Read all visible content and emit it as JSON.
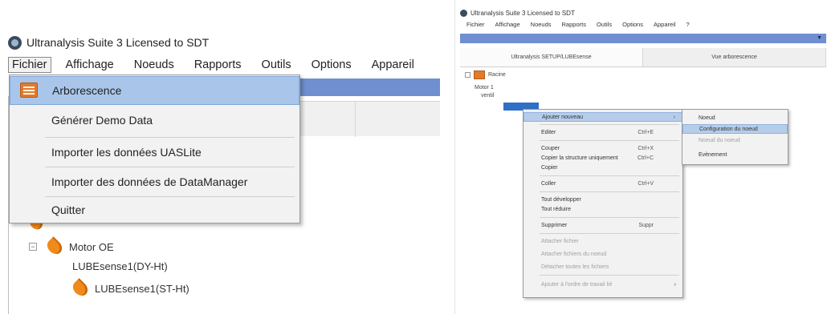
{
  "left": {
    "title": "Ultranalysis Suite 3 Licensed to SDT",
    "menubar": [
      "Fichier",
      "Affichage",
      "Noeuds",
      "Rapports",
      "Outils",
      "Options",
      "Appareil"
    ],
    "fichier_menu": [
      {
        "label": "Arborescence",
        "active": true
      },
      {
        "label": "Générer Demo Data"
      },
      {
        "label": "Importer les données UASLite"
      },
      {
        "label": "Importer des données de DataManager"
      },
      {
        "label": "Quitter"
      }
    ],
    "tree": {
      "motor": "Motor OE",
      "lube1": "LUBEsense1(DY-Ht)",
      "lube2": "LUBEsense1(ST-Ht)"
    }
  },
  "right": {
    "title": "Ultranalysis Suite 3 Licensed to SDT",
    "menubar": [
      "Fichier",
      "Affichage",
      "Noeuds",
      "Rapports",
      "Outils",
      "Options",
      "Appareil",
      "?"
    ],
    "tabs": [
      "Ultranalysis SETUP/LUBEsense",
      "Vue arborescence"
    ],
    "tree": [
      "Racine",
      "Motor 1",
      "ventil"
    ],
    "context_menu": [
      {
        "label": "Ajouter nouveau",
        "arrow": "›",
        "active": true
      },
      {
        "label": "Editer",
        "shortcut": "Ctrl+E"
      },
      {
        "label": "Couper",
        "shortcut": "Ctrl+X"
      },
      {
        "label": "Copier la structure uniquement",
        "shortcut": "Ctrl+C"
      },
      {
        "label": "Copier"
      },
      {
        "label": "Coller",
        "shortcut": "Ctrl+V"
      },
      {
        "label": "Tout développer"
      },
      {
        "label": "Tout réduire"
      },
      {
        "label": "Supprimer",
        "shortcut": "Suppr"
      },
      {
        "label": "Attacher fichier",
        "disabled": true
      },
      {
        "label": "Attacher fichiers du noeud",
        "disabled": true
      },
      {
        "label": "Détacher toutes les fichiers",
        "disabled": true
      },
      {
        "label": "Ajouter à l'ordre de travail lié",
        "arrow": "›",
        "disabled": true
      }
    ],
    "submenu": [
      {
        "label": "Noeud"
      },
      {
        "label": "Configuration du noeud",
        "active": true
      },
      {
        "label": "Noeud du noeud",
        "disabled": true
      },
      {
        "label": "Evènement"
      }
    ]
  }
}
